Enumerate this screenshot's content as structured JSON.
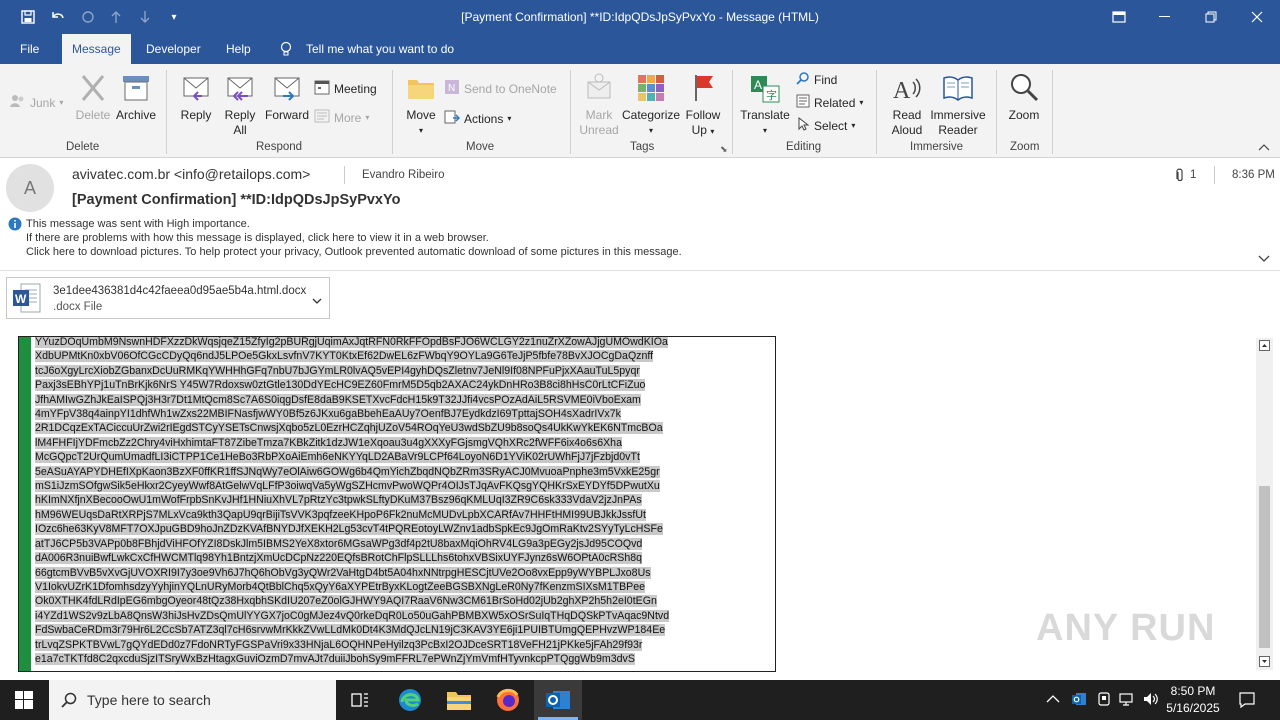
{
  "window": {
    "title": "[Payment Confirmation] **ID:IdpQDsJpSyPvxYo  -  Message (HTML)"
  },
  "menu_tabs": [
    "File",
    "Message",
    "Developer",
    "Help"
  ],
  "tell_me": "Tell me what you want to do",
  "ribbon": {
    "junk": "Junk",
    "delete": "Delete",
    "archive": "Archive",
    "group_delete": "Delete",
    "reply": "Reply",
    "reply_all_1": "Reply",
    "reply_all_2": "All",
    "forward": "Forward",
    "meeting": "Meeting",
    "more": "More",
    "group_respond": "Respond",
    "move": "Move",
    "send_onenote": "Send to OneNote",
    "actions": "Actions",
    "group_move": "Move",
    "mark_unread_1": "Mark",
    "mark_unread_2": "Unread",
    "categorize": "Categorize",
    "follow_up_1": "Follow",
    "follow_up_2": "Up",
    "group_tags": "Tags",
    "translate": "Translate",
    "find": "Find",
    "related": "Related",
    "select": "Select",
    "group_editing": "Editing",
    "read_aloud_1": "Read",
    "read_aloud_2": "Aloud",
    "immersive_1": "Immersive",
    "immersive_2": "Reader",
    "group_immersive": "Immersive",
    "zoom": "Zoom",
    "group_zoom": "Zoom"
  },
  "message": {
    "avatar_letter": "A",
    "sender": "avivatec.com.br <info@retailops.com>",
    "recipient": "Evandro Ribeiro",
    "attachment_count": "1",
    "time": "8:36 PM",
    "subject": "[Payment Confirmation] **ID:IdpQDsJpSyPvxYo",
    "info_1": "This message was sent with High importance.",
    "info_2": "If there are problems with how this message is displayed, click here to view it in a web browser.",
    "info_3": "Click here to download pictures. To help protect your privacy, Outlook prevented automatic download of some pictures in this message."
  },
  "attachment": {
    "name": "3e1dee436381d4c42faeea0d95ae5b4a.html.docx",
    "type": ".docx File"
  },
  "body_lines": [
    "YYuzDOqUmbM9NswnHDFXzzDkWqsjqeZ15ZfyIg2pBURgjUqimAxJqtRFN0RkFFOpdBsFJO6WCLGY2z1nuZrXZowAJjgUMOwdKIOa",
    "XdbUPMtKn0xbV06OfCGcCDyQq6ndJ5LPOe5GkxLsvfnV7KYT0KtxEf62DwEL6zFWbqY9OYLa9G6TeJjP5fbfe78BvXJOCgDaQznff",
    "tcJ6oXgyLrcXiobZGbanxDcUuRMKqYWHHhGFq7nbU7bJGYmLR0lvAQ5vEPI4gyhDQsZletnv7JeNl9If08NPFuPjxXAauTuL5pyqr",
    "Paxj3sEBhYPj1uTnBrKjk6NrS Y45W7Rdoxsw0ztGtle130DdYEcHC9EZ60FmrM5D5qb2AXAC24ykDnHRo3B8ci8hHsC0rLtCFiZuo",
    "JfhAMIwGZhJkEaISPQj3H3r7Dt1MtQcm8Sc7A6S0iqgDsfE8daB9KSETXvcFdcH15k9T32JJfi4vcsPOzAdAiL5RSVME0iVboExam",
    "4mYFpV38q4ainpYI1dhfWh1wZxs22MBIFNasfjwWY0Bf5z6JKxu6gaBbehEaAUy7OenfBJ7EydkdzI69TpttajSOH4sXadrIVx7k",
    "2R1DCqzExTACiccuUrZwi2rIEgdSTCyYSETsCnwsjXqbo5zL0EzrHCZqhjUZoV54ROqYeU3wdSbZU9b8soQs4UkKwYkEK6NTmcBOa",
    "lM4FHFIjYDFmcbZz2Chry4viHxhimtaFT87ZibeTmza7KBkZitk1dzJW1eXqoau3u4gXXXyFGjsmgVQhXRc2fWFF6ix4o6s6Xha",
    "McGQpcT2UrQumUmadfLI3iCTPP1Ce1HeBo3RbPXoAiEmh6eNKYYqLD2ABaVr9LCPf64LoyoN6D1YViK02rUWhFjJ7jFzbjd0vTt",
    "5eASuAYAPYDHEfIXpKaon3BzXF0ffKR1ffSJNqWy7eOlAiw6GOWg6b4QmYichZbqdNQbZRm3SRyACJ0MvuoaPnphe3m5VxkE25gr",
    "mS1iJzmSOfgwSik5eHkxr2CyeyWwf8AtGelwVqLFfP3oiwqVa5yWgSZHcmvPwoWQPr4OIJsTJqAvFKQsgYQHKrSxEYDYf5DPwutXu",
    "hKImNXfjnXBecooOwU1mWofFrpbSnKvJHf1HNiuXhVL7pRtzYc3tpwkSLftyDKuM37Bsz96qKMLUqI3ZR9C6sk333VdaV2jzJnPAs",
    "hM96WEUqsDaRtXRPjS7MLxVca9kth3QapU9qrBijiTsVVK3pqfzeeKHpoP6Fk2nuMcMUDvLpbXCARfAv7HHFtHMI99UBJkkJssfUt",
    "IOzc6he63KyV8MFT7OXJpuGBD9hoJnZDzKVAfBNYDJfXEKH2Lg53cvT4tPQREotoyLWZnv1adbSpkEc9JgOmRaKtv2SYyTyLcHSFe",
    "atTJ6CP5b3VAPp0b8FBhjdViHFOfYZI8DskJlm5IBMS2YeX8xtor6MGsaWPg3df4p2tU8baxMqiOhRV4LG9a3pEGy2jsJd95COQvd",
    "dA006R3nuiBwfLwkCxCfHWCMTlq98Yh1BntzjXmUcDCpNz220EQfsBRotChFlpSLLLhs6tohxVBSixUYFJynz6sW6OPtA0cRSh8q",
    "66gtcmBVvB5vXvGjUVOXRI9I7y3oe9Vh6J7hQ6hObVg3yQWr2VaHtgD4bt5A04hxNNtrpgHESCjtUVe2Oo8vxEpp9yWYBPLJxo8Us",
    "V1IokvUZrK1DfomhsdzyYyhjinYQLnURyMorb4QtBblChq5xQyY6aXYPEtrByxKLogtZeeBGSBXNgLeR0Ny7fKenzmSIXsM1TBPee",
    "Ok0XTHK4fdLRdIpEG6mbgOyeor48tQz38HxqbhSKdIU207eZ0olGJHWY9AQI7RaaV6Nw3CM61BrSoHd02jUb2ghXP2h5h2eI0tEGn",
    "i4YZd1WS2v9zLbA8QnsW3hiJsHvZDsQmUlYYGX7joC0gMJez4vQ0rkeDqR0Lo50uGahPBMBXW5xOSrSuIqTHqDQSkPTvAqac9Ntvd",
    "FdSwbaCeRDm3r79Hr6L2CcSb7ATZ3ql7cH6srvwMrKkkZVwLLdMk0Dt4K3MdQJcLN19jC3KAV3YE6ji1PUIBTUmgQEPHvzWP184Ee",
    "trLvqZSPKTBVwL7gQYdEDd0z7FdoNRTyFGSPaVri9x33HNjaL6OQHNPeHyilzq3PcBxI2OJDceSRT18VeFH21jPKke5jFAh29f93r",
    "e1a7cTKTfd8C2qxcduSjzITSryWxBzHtagxGuviOzmD7mvAJt7duiiJbohSy9mFFRL7ePWnZjYmVmfHTyvnkcpPTQggWb9m3dvS"
  ],
  "taskbar": {
    "search_placeholder": "Type here to search",
    "time": "8:50 PM",
    "date": "5/16/2025"
  },
  "watermark": "ANY RUN"
}
